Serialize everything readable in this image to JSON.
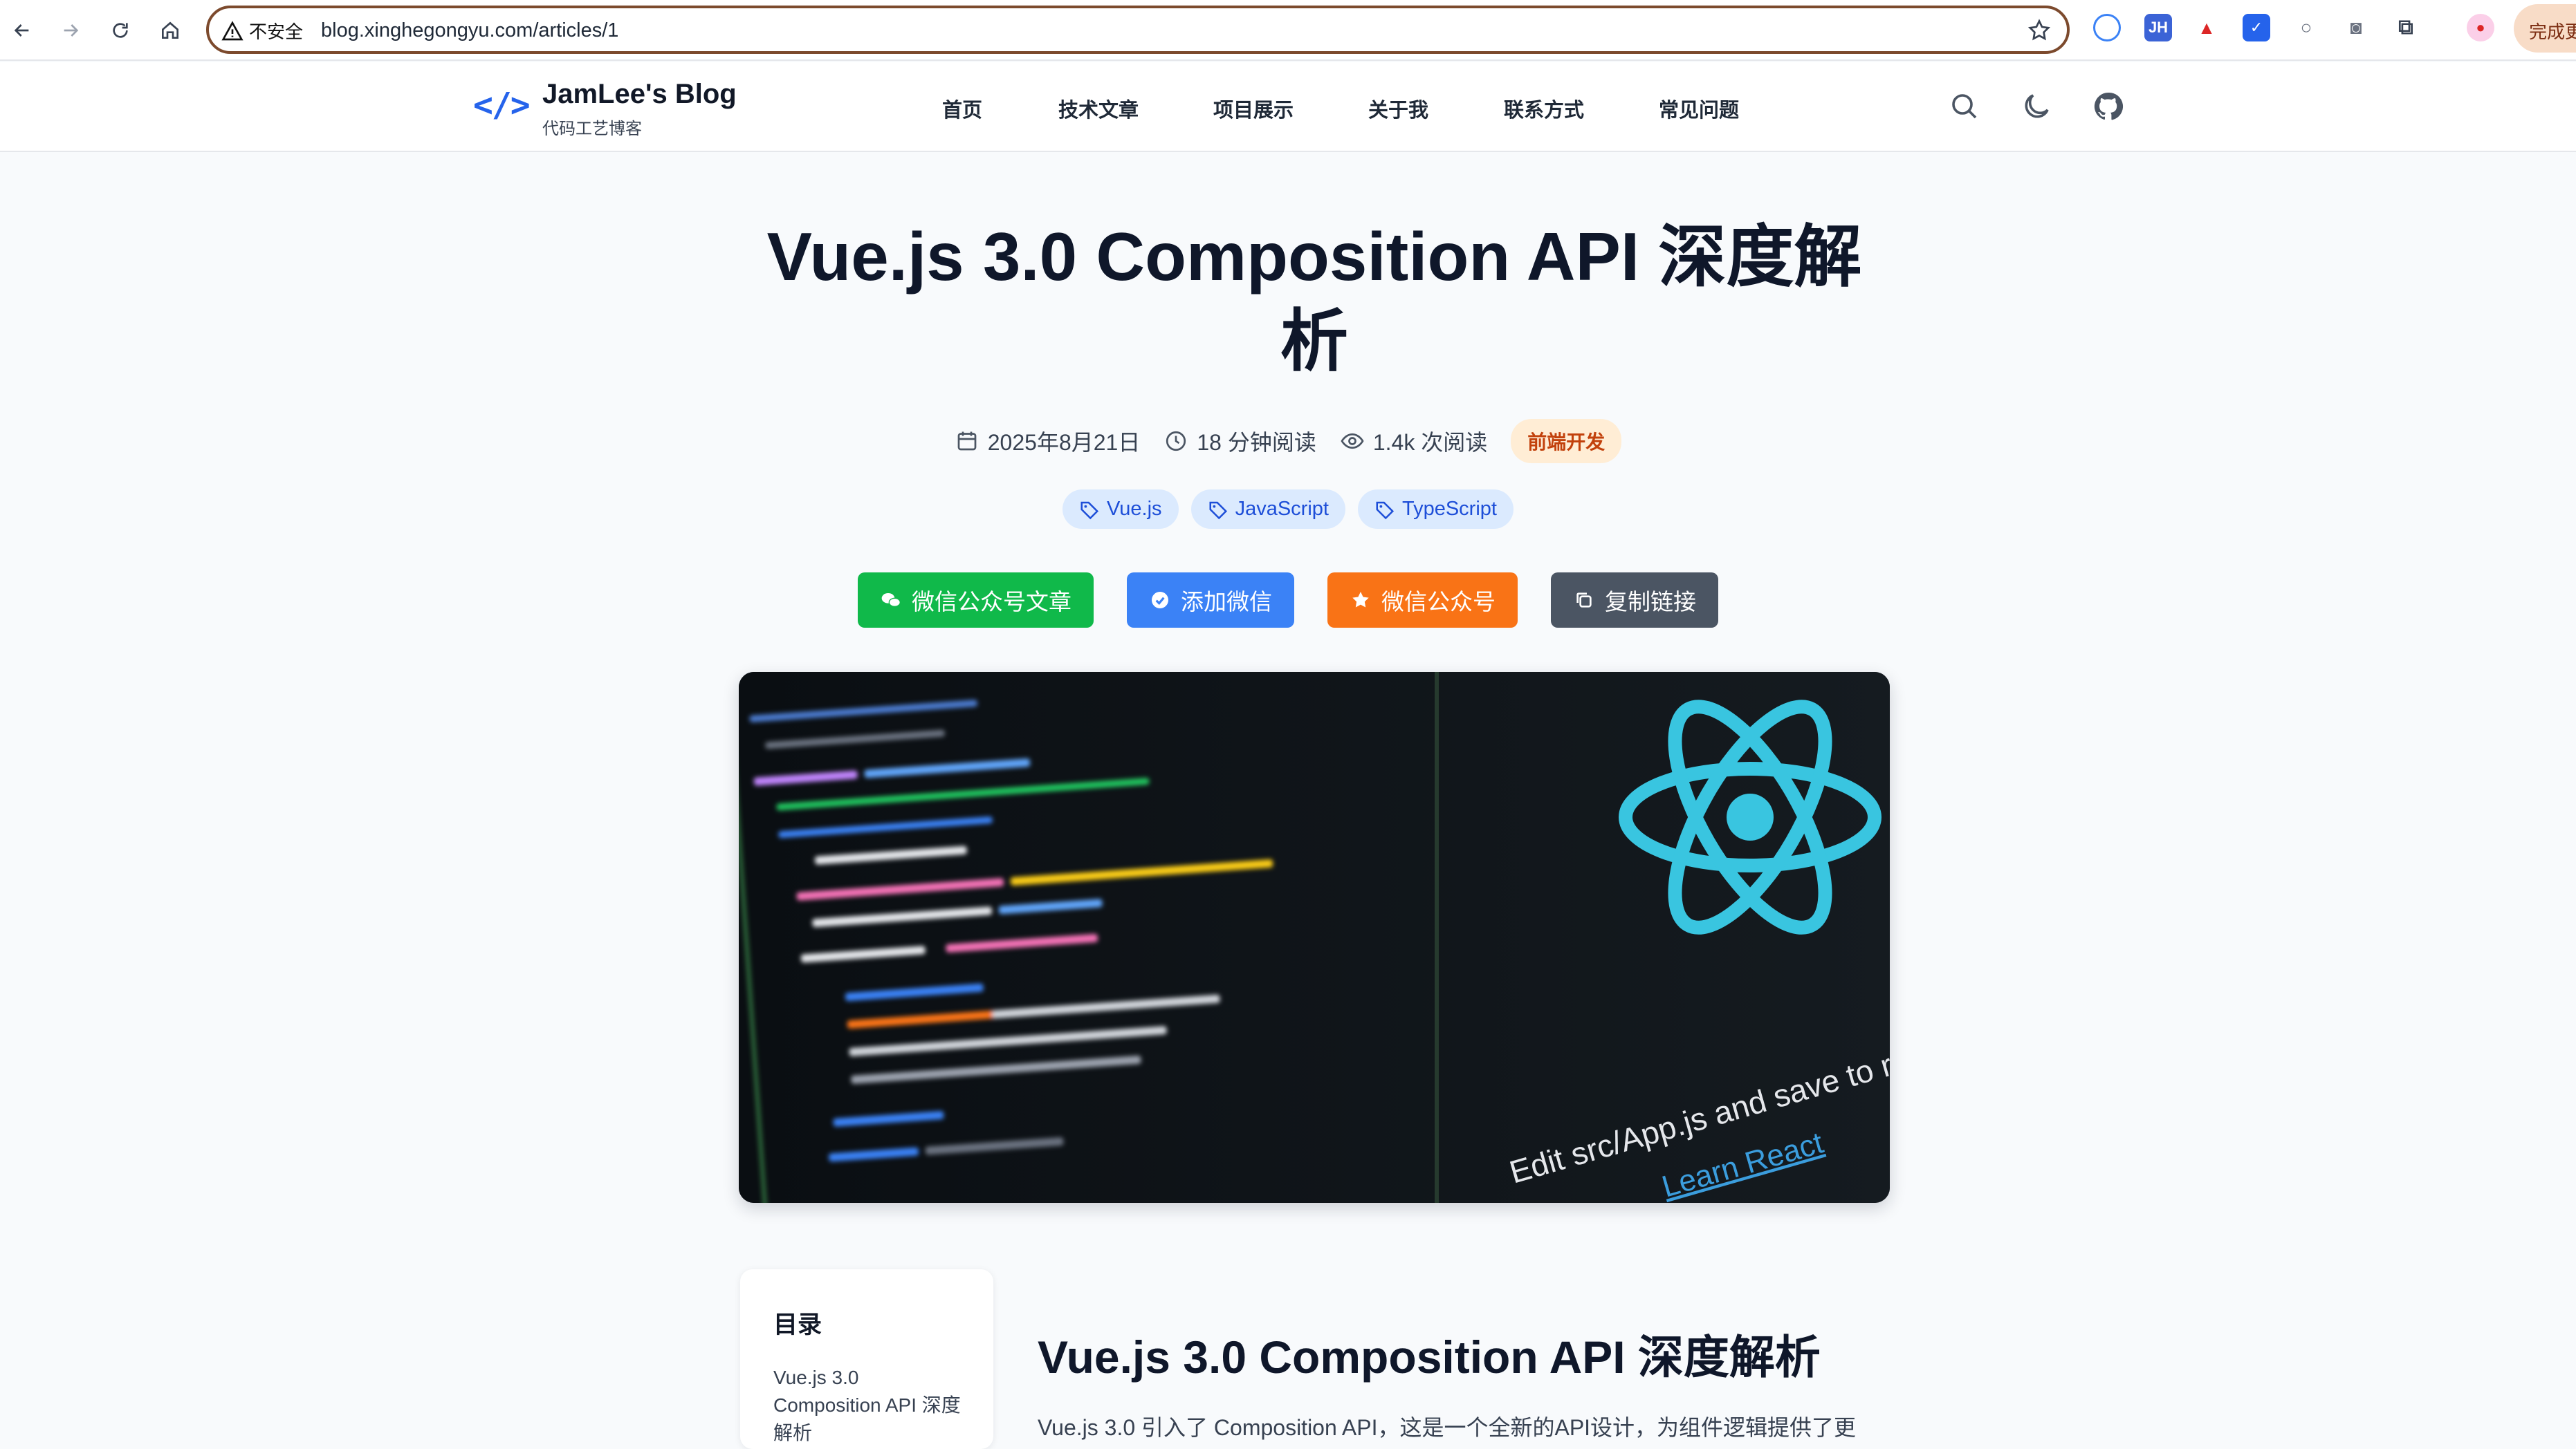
{
  "browser": {
    "security_label": "不安全",
    "url": "blog.xinghegongyu.com/articles/1",
    "profile_button": "完成更"
  },
  "site": {
    "logo_mark": "</>",
    "title": "JamLee's Blog",
    "subtitle": "代码工艺博客",
    "nav": [
      "首页",
      "技术文章",
      "项目展示",
      "关于我",
      "联系方式",
      "常见问题"
    ]
  },
  "article": {
    "title_line1": "Vue.js 3.0 Composition API 深度解",
    "title_line2": "析",
    "date": "2025年8月21日",
    "read_time": "18 分钟阅读",
    "views": "1.4k 次阅读",
    "category": "前端开发",
    "tags": [
      "Vue.js",
      "JavaScript",
      "TypeScript"
    ],
    "actions": {
      "wechat_article": "微信公众号文章",
      "add_wechat": "添加微信",
      "wechat_official": "微信公众号",
      "copy_link": "复制链接"
    },
    "hero_caption": "Edit src/App.js and save to relo",
    "hero_link": "Learn React"
  },
  "toc": {
    "title": "目录",
    "first_item": "Vue.js 3.0 Composition API 深度解析"
  },
  "content": {
    "heading": "Vue.js 3.0 Composition API 深度解析",
    "intro": "Vue.js 3.0 引入了 Composition API，这是一个全新的API设计，为组件逻辑提供了更"
  },
  "colors": {
    "brand": "#2563eb",
    "wechat_green": "#10b94a",
    "blue_button": "#3b82f6",
    "orange_button": "#f97316",
    "gray_button": "#4b5563",
    "react_cyan": "#39c5e0"
  }
}
